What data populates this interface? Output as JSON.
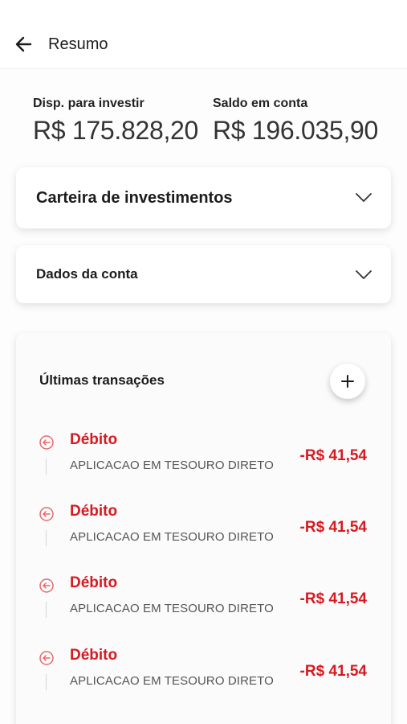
{
  "header": {
    "title": "Resumo",
    "back_icon": "arrow-left-icon"
  },
  "balances": {
    "invest": {
      "label": "Disp. para investir",
      "value": "R$ 175.828,20"
    },
    "saldo": {
      "label": "Saldo em conta",
      "value": "R$ 196.035,90"
    }
  },
  "sections": {
    "carteira": {
      "title": "Carteira de investimentos",
      "icon": "chevron-down-icon"
    },
    "dados": {
      "title": "Dados da conta",
      "icon": "chevron-down-icon"
    }
  },
  "transactions": {
    "title": "Últimas transações",
    "add_icon": "plus-icon",
    "items": [
      {
        "type": "Débito",
        "description": "APLICACAO EM TESOURO DIRETO",
        "amount": "-R$ 41,54",
        "icon": "arrow-left-circle-icon"
      },
      {
        "type": "Débito",
        "description": "APLICACAO EM TESOURO DIRETO",
        "amount": "-R$ 41,54",
        "icon": "arrow-left-circle-icon"
      },
      {
        "type": "Débito",
        "description": "APLICACAO EM TESOURO DIRETO",
        "amount": "-R$ 41,54",
        "icon": "arrow-left-circle-icon"
      },
      {
        "type": "Débito",
        "description": "APLICACAO EM TESOURO DIRETO",
        "amount": "-R$ 41,54",
        "icon": "arrow-left-circle-icon"
      }
    ]
  },
  "colors": {
    "debit": "#d71920",
    "text": "#1c1c1c",
    "muted": "#555555"
  }
}
